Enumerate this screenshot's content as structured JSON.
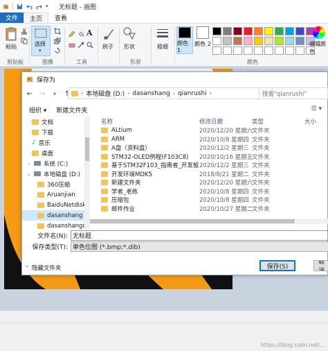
{
  "window": {
    "title": "无标题 - 画图"
  },
  "ribbon_tabs": {
    "file": "文件",
    "home": "主页",
    "view": "查看"
  },
  "ribbon": {
    "paste": "粘贴",
    "select": "选择",
    "brush": "刷子",
    "shapes": "形状",
    "outline": "粗细",
    "color1": "颜色 1",
    "color2": "颜色 2",
    "edit_colors": "编辑颜色",
    "groups": {
      "clipboard": "剪贴板",
      "image": "图像",
      "tools": "工具",
      "shapes": "形状",
      "colors": "颜色"
    },
    "palette": [
      "#000000",
      "#7f7f7f",
      "#880015",
      "#ed1c24",
      "#ff7f27",
      "#fff200",
      "#22b14c",
      "#00a2e8",
      "#3f48cc",
      "#a349a4",
      "#ffffff",
      "#c3c3c3",
      "#b97a57",
      "#ffaec9",
      "#ffc90e",
      "#efe4b0",
      "#b5e61d",
      "#99d9ea",
      "#7092be",
      "#c8bfe7",
      "#ffffff",
      "#ffffff",
      "#ffffff",
      "#ffffff",
      "#ffffff",
      "#ffffff",
      "#ffffff",
      "#ffffff",
      "#ffffff",
      "#ffffff"
    ]
  },
  "dialog": {
    "title": "保存为",
    "address": [
      "本地磁盘 (D:)",
      "dasanshang",
      "qianrushi"
    ],
    "search_placeholder": "搜索\"qianrushi\"",
    "organize": "组织 ▾",
    "new_folder": "新建文件夹",
    "nav_items": [
      {
        "label": "文档",
        "kind": "folder"
      },
      {
        "label": "下载",
        "kind": "folder"
      },
      {
        "label": "音乐",
        "kind": "music"
      },
      {
        "label": "桌面",
        "kind": "folder"
      },
      {
        "label": "系统 (C:)",
        "kind": "drive"
      },
      {
        "label": "本地磁盘 (D:)",
        "kind": "drive"
      },
      {
        "label": "360压缩",
        "kind": "folder"
      },
      {
        "label": "Aruanjian",
        "kind": "folder"
      },
      {
        "label": "BaiduNetdiskl",
        "kind": "folder"
      },
      {
        "label": "dasanshang",
        "kind": "folder"
      },
      {
        "label": "dasanshangoi",
        "kind": "folder"
      }
    ],
    "columns": {
      "name": "名称",
      "date": "修改日期",
      "type": "类型",
      "size": "大小"
    },
    "files": [
      {
        "name": "ALtium",
        "date": "2020/12/20 星期六",
        "type": "文件夹"
      },
      {
        "name": "ARM",
        "date": "2020/10/8 星期四",
        "type": "文件夹"
      },
      {
        "name": "A盘（资料盘）",
        "date": "2020/12/2 星期三",
        "type": "文件夹"
      },
      {
        "name": "STM32-OLED例程(F103C8)",
        "date": "2020/10/16 星期五",
        "type": "文件夹"
      },
      {
        "name": "基于STM32F103_指南者_开发板",
        "date": "2020/12/2 星期三",
        "type": "文件夹"
      },
      {
        "name": "开发环境MDK5",
        "date": "2018/8/21 星期二",
        "type": "文件夹"
      },
      {
        "name": "新建文件夹",
        "date": "2020/12/20 星期六",
        "type": "文件夹"
      },
      {
        "name": "学者_老栋",
        "date": "2020/10/8 星期四",
        "type": "文件夹"
      },
      {
        "name": "压缩包",
        "date": "2020/10/8 星期四",
        "type": "文件夹"
      },
      {
        "name": "邮件作业",
        "date": "2020/10/27 星期二",
        "type": "文件夹"
      }
    ],
    "filename_label": "文件名(N):",
    "filename_value": "无标题",
    "filetype_label": "保存类型(T):",
    "filetype_value": "单色位图 (*.bmp;*.dib)",
    "hide_folders": "隐藏文件夹",
    "save_button": "保存(S)",
    "cancel_button": "取消"
  },
  "watermark": "https://blog.csdn.net/..."
}
